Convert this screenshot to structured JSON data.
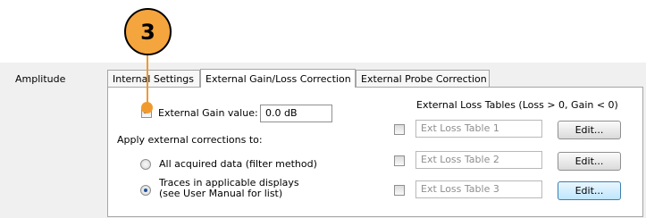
{
  "callout": {
    "number": "3"
  },
  "section_label": "Amplitude",
  "tabs": [
    {
      "label": "Internal Settings",
      "active": false
    },
    {
      "label": "External Gain/Loss Correction",
      "active": true
    },
    {
      "label": "External Probe Correction",
      "active": false
    }
  ],
  "gain": {
    "checkbox_checked": true,
    "label": "External Gain value:",
    "value": "0.0 dB"
  },
  "apply": {
    "heading": "Apply external corrections to:",
    "options": [
      {
        "label": "All acquired data (filter method)",
        "selected": false
      },
      {
        "line1": "Traces in applicable displays",
        "line2": "(see User Manual for list)",
        "selected": true
      }
    ]
  },
  "loss_tables": {
    "heading": "External Loss Tables (Loss > 0, Gain < 0)",
    "rows": [
      {
        "checked": false,
        "name": "Ext Loss Table 1",
        "button": "Edit..."
      },
      {
        "checked": false,
        "name": "Ext Loss Table 2",
        "button": "Edit..."
      },
      {
        "checked": false,
        "name": "Ext Loss Table 3",
        "button": "Edit..."
      }
    ]
  },
  "colors": {
    "callout_fill": "#f5a53d",
    "callout_line": "#f09a2e"
  }
}
